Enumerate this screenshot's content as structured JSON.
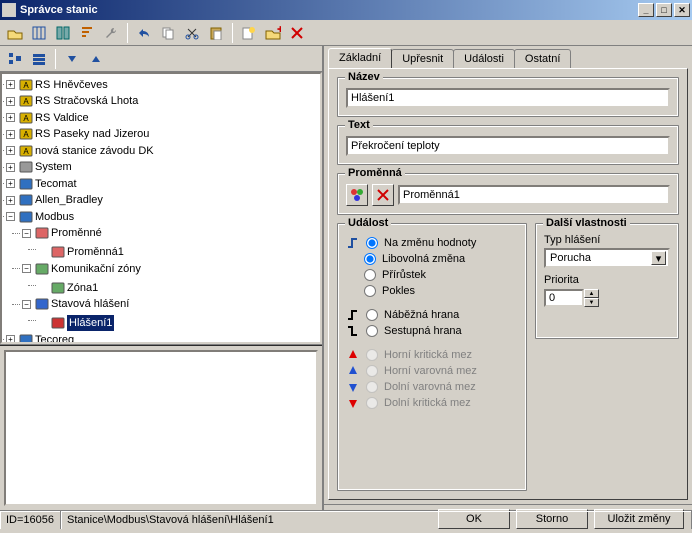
{
  "window": {
    "title": "Správce stanic"
  },
  "tree": {
    "items": [
      {
        "pm": "+",
        "label": "RS Hněvčeves",
        "iconColor": "#d8b000",
        "iconText": "A"
      },
      {
        "pm": "+",
        "label": "RS Stračovská Lhota",
        "iconColor": "#d8b000",
        "iconText": "A"
      },
      {
        "pm": "+",
        "label": "RS Valdice",
        "iconColor": "#d8b000",
        "iconText": "A"
      },
      {
        "pm": "+",
        "label": "RS Paseky nad Jizerou",
        "iconColor": "#d8b000",
        "iconText": "A"
      },
      {
        "pm": "+",
        "label": "nová stanice závodu DK",
        "iconColor": "#d8b000",
        "iconText": "A"
      },
      {
        "pm": "+",
        "label": "System",
        "iconColor": "#999",
        "iconText": ""
      },
      {
        "pm": "+",
        "label": "Tecomat",
        "iconColor": "#3070c0",
        "iconText": ""
      },
      {
        "pm": "+",
        "label": "Allen_Bradley",
        "iconColor": "#3070c0",
        "iconText": ""
      },
      {
        "pm": "−",
        "label": "Modbus",
        "iconColor": "#3070c0",
        "iconText": "",
        "children": [
          {
            "pm": "−",
            "label": "Proměnné",
            "iconColor": "#d66",
            "iconText": "",
            "children": [
              {
                "pm": "",
                "label": "Proměnná1",
                "iconColor": "#d66",
                "iconText": ""
              }
            ]
          },
          {
            "pm": "−",
            "label": "Komunikační zóny",
            "iconColor": "#6a6",
            "iconText": "",
            "children": [
              {
                "pm": "",
                "label": "Zóna1",
                "iconColor": "#6a6",
                "iconText": ""
              }
            ]
          },
          {
            "pm": "−",
            "label": "Stavová hlášení",
            "iconColor": "#36c",
            "iconText": "",
            "children": [
              {
                "pm": "",
                "label": "Hlášení1",
                "selected": true,
                "iconColor": "#c33",
                "iconText": ""
              }
            ]
          }
        ]
      },
      {
        "pm": "+",
        "label": "Tecoreg",
        "iconColor": "#3070c0",
        "iconText": ""
      }
    ]
  },
  "tabs": [
    "Základní",
    "Upřesnit",
    "Události",
    "Ostatní"
  ],
  "form": {
    "nazev_label": "Název",
    "nazev_value": "Hlášení1",
    "text_label": "Text",
    "text_value": "Překročení teploty",
    "promenna_label": "Proměnná",
    "promenna_value": "Proměnná1"
  },
  "udalost": {
    "title": "Událost",
    "opts": {
      "na_zmenu": "Na změnu hodnoty",
      "libovolna": "Libovolná změna",
      "prirustek": "Přírůstek",
      "pokles": "Pokles",
      "nabezna": "Náběžná hrana",
      "sestupna": "Sestupná hrana",
      "horni_kr": "Horní kritická mez",
      "horni_var": "Horní varovná mez",
      "dolni_var": "Dolní varovná mez",
      "dolni_kr": "Dolní kritická mez"
    }
  },
  "dalsi": {
    "title": "Další vlastnosti",
    "typ_label": "Typ hlášení",
    "typ_value": "Porucha",
    "priorita_label": "Priorita",
    "priorita_value": "0"
  },
  "buttons": {
    "ok": "OK",
    "storno": "Storno",
    "ulozit": "Uložit změny"
  },
  "status": {
    "id": "ID=16056",
    "path": "Stanice\\Modbus\\Stavová hlášení\\Hlášení1"
  }
}
